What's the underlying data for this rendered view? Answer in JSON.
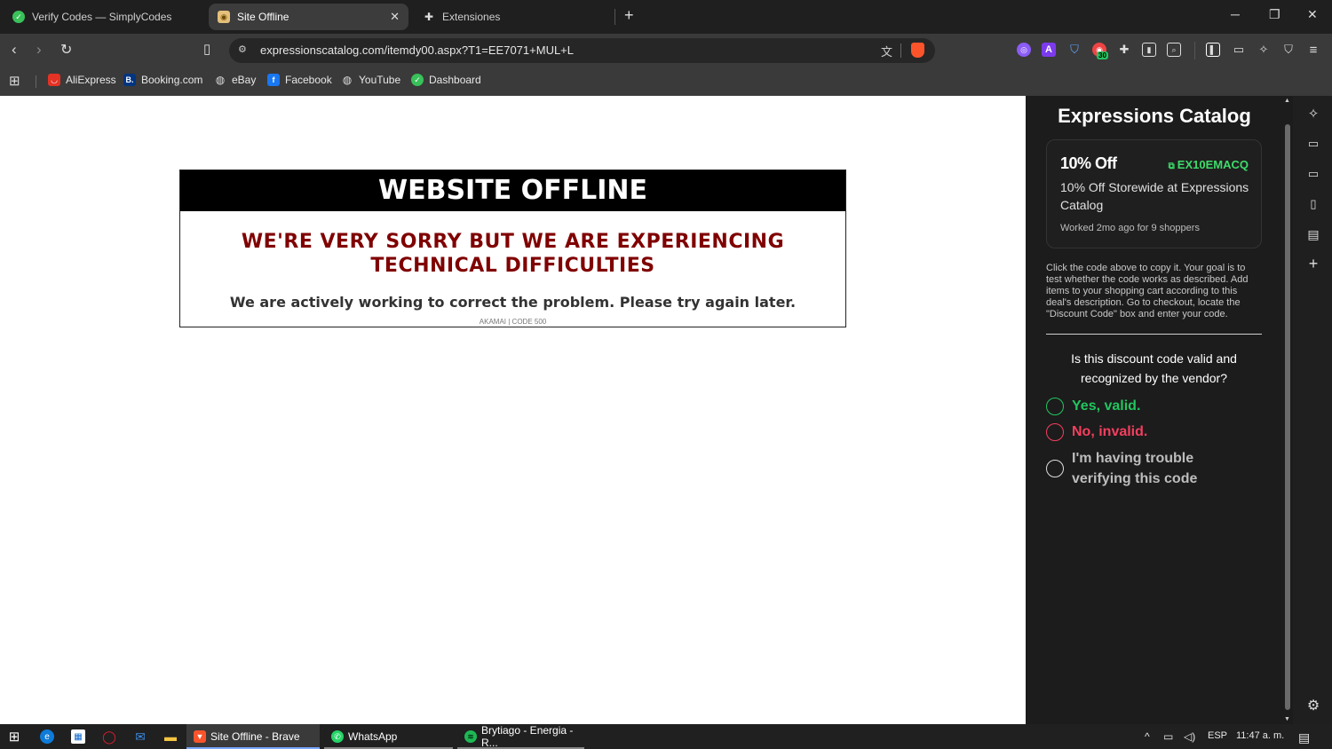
{
  "browser": {
    "tabs": [
      {
        "label": "Verify Codes — SimplyCodes",
        "icon": "simplycodes-icon"
      },
      {
        "label": "Site Offline",
        "icon": "site-favicon",
        "close": "✕"
      },
      {
        "label": "Extensiones",
        "icon": "puzzle-icon"
      }
    ],
    "new_tab": "+",
    "window_controls": {
      "minimize": "─",
      "restore": "❐",
      "close": "✕"
    },
    "url": "expressionscatalog.com/itemdy00.aspx?T1=EE7071+MUL+L",
    "extension_badge": "30",
    "bookmarks": [
      {
        "label": "AliExpress",
        "icon": "aliexpress-icon"
      },
      {
        "label": "Booking.com",
        "icon": "booking-icon"
      },
      {
        "label": "eBay",
        "icon": "globe-icon"
      },
      {
        "label": "Facebook",
        "icon": "facebook-icon"
      },
      {
        "label": "YouTube",
        "icon": "globe-icon"
      },
      {
        "label": "Dashboard",
        "icon": "simplycodes-icon"
      }
    ]
  },
  "page": {
    "header": "WEBSITE OFFLINE",
    "sorry_line1": "WE'RE VERY SORRY BUT WE ARE EXPERIENCING",
    "sorry_line2": "TECHNICAL DIFFICULTIES",
    "message": "We are actively working to correct the problem. Please try again later.",
    "code": "AKAMAI | CODE 500"
  },
  "panel": {
    "title": "Expressions Catalog",
    "deal": {
      "discount": "10% Off",
      "code": "EX10EMACQ",
      "description": "10% Off Storewide at Expressions Catalog",
      "worked": "Worked 2mo ago for 9 shoppers"
    },
    "instructions": "Click the code above to copy it. Your goal is to test whether the code works as described. Add items to your shopping cart according to this deal's description. Go to checkout, locate the \"Discount Code\" box and enter your code.",
    "question": "Is this discount code valid and recognized by the vendor?",
    "options": [
      {
        "label": "Yes, valid.",
        "color": "#22c55e"
      },
      {
        "label": "No, invalid.",
        "color": "#f43f5e"
      },
      {
        "label": "I'm having trouble verifying this code",
        "color": "#bdbdbd"
      }
    ]
  },
  "taskbar": {
    "apps": [
      {
        "label": "Site Offline - Brave",
        "icon": "brave-icon"
      },
      {
        "label": "WhatsApp",
        "icon": "whatsapp-icon"
      },
      {
        "label": "Brytiago - Energia - R...",
        "icon": "spotify-icon"
      }
    ],
    "language": "ESP",
    "time": "11:47 a. m."
  },
  "colors": {
    "accent_green": "#3ddc6a",
    "offline_red": "#800000"
  }
}
